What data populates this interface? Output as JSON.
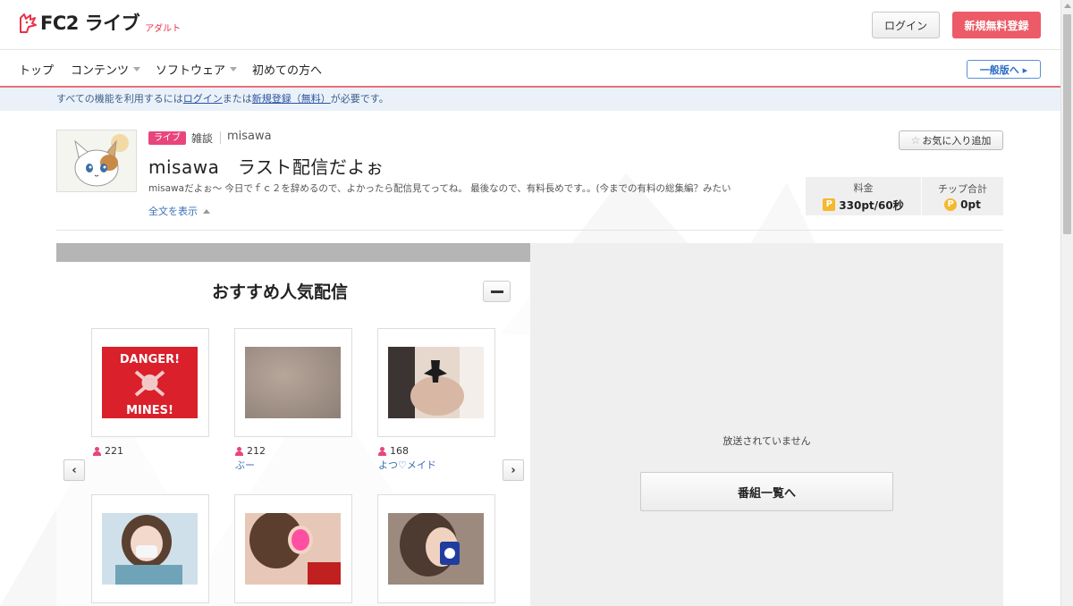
{
  "header": {
    "logo_text": "FC2 ライブ",
    "logo_sub": "アダルト",
    "login_label": "ログイン",
    "register_label": "新規無料登録"
  },
  "nav": {
    "items": [
      {
        "label": "トップ"
      },
      {
        "label": "コンテンツ"
      },
      {
        "label": "ソフトウェア"
      },
      {
        "label": "初めての方へ"
      }
    ],
    "general_label": "一般版へ ▸"
  },
  "notice": {
    "prefix": "すべての機能を利用するには",
    "login_link": "ログイン",
    "middle": "または",
    "register_link": "新規登録（無料）",
    "suffix": "が必要です。"
  },
  "profile": {
    "tag": "ライブ",
    "category": "雑談",
    "username": "misawa",
    "title": "misawa　ラスト配信だよぉ",
    "description": "misawaだよぉ～ 今日でｆｃ２を辞めるので、よかったら配信見てってね。 最後なので、有料長めです。。(今までの有料の総集編？みたい",
    "fulltext_label": "全文を表示",
    "fav_label": "お気に入り追加",
    "price_label": "料金",
    "price_value": "330pt/60秒",
    "tip_label": "チップ合計",
    "tip_value": "0pt"
  },
  "recommend": {
    "title": "おすすめ人気配信",
    "items": [
      {
        "viewers": "221",
        "name": "",
        "danger_top": "DANGER!",
        "danger_bottom": "MINES!"
      },
      {
        "viewers": "212",
        "name": "ぶー"
      },
      {
        "viewers": "168",
        "name": "よつ♡メイド"
      },
      {
        "viewers": "",
        "name": ""
      },
      {
        "viewers": "",
        "name": ""
      },
      {
        "viewers": "",
        "name": ""
      }
    ],
    "prev_label": "‹",
    "next_label": "›"
  },
  "player": {
    "offline_text": "放送されていません",
    "program_button": "番組一覧へ"
  },
  "colors": {
    "accent_red": "#ec5b67",
    "live_pink": "#e8457c",
    "link_blue": "#3b6fb6",
    "point_gold": "#f5b82e"
  }
}
